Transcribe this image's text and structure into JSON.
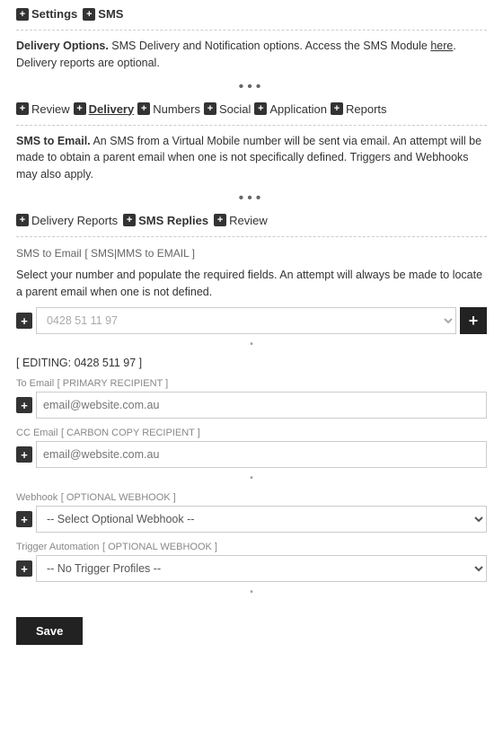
{
  "topBar": {
    "items": [
      {
        "label": "Settings",
        "plusIcon": true
      },
      {
        "label": "SMS",
        "plusIcon": true
      }
    ]
  },
  "deliveryOptions": {
    "description": "Delivery Options. SMS Delivery and Notification options. Access the SMS Module ",
    "linkText": "here",
    "description2": ".",
    "note": "Delivery reports are optional."
  },
  "mainTabs": [
    {
      "label": "Review",
      "plusIcon": true,
      "active": false
    },
    {
      "label": "Delivery",
      "plusIcon": true,
      "active": true
    },
    {
      "label": "Numbers",
      "plusIcon": true,
      "active": false
    },
    {
      "label": "Social",
      "plusIcon": true,
      "active": false
    },
    {
      "label": "Application",
      "plusIcon": true,
      "active": false
    },
    {
      "label": "Reports",
      "plusIcon": true,
      "active": false
    }
  ],
  "smsToEmail": {
    "description": "SMS to Email. An SMS from a Virtual Mobile number will be sent via email. An attempt will be made to obtain a parent email when one is not specifically defined. Triggers and Webhooks may also apply."
  },
  "subTabs": [
    {
      "label": "Delivery Reports",
      "plusIcon": true,
      "active": false
    },
    {
      "label": "SMS Replies",
      "plusIcon": true,
      "active": true
    },
    {
      "label": "Review",
      "plusIcon": true,
      "active": false
    }
  ],
  "formSection": {
    "title": "SMS to Email",
    "titleBracket": "[ SMS|MMS to EMAIL ]",
    "description": "Select your number and populate the required fields. An attempt will always be made to locate a parent email when one is not defined.",
    "numberPlaceholder": "0428 51 11 97",
    "editingLabel": "[ EDITING: 0428 511 97 ]",
    "toEmailLabel": "To Email",
    "toEmailBracket": "[ PRIMARY RECIPIENT ]",
    "toEmailPlaceholder": "email@website.com.au",
    "ccEmailLabel": "CC Email",
    "ccEmailBracket": "[ CARBON COPY RECIPIENT ]",
    "ccEmailPlaceholder": "email@website.com.au",
    "webhookLabel": "Webhook",
    "webhookBracket": "[ OPTIONAL WEBHOOK ]",
    "webhookPlaceholder": "-- Select Optional Webhook --",
    "webhookOptions": [
      "-- Select Optional Webhook --"
    ],
    "triggerLabel": "Trigger Automation",
    "triggerBracket": "[ OPTIONAL WEBHOOK ]",
    "triggerPlaceholder": "-- No Trigger Profiles --",
    "triggerOptions": [
      "-- No Trigger Profiles --"
    ],
    "saveLabel": "Save"
  }
}
